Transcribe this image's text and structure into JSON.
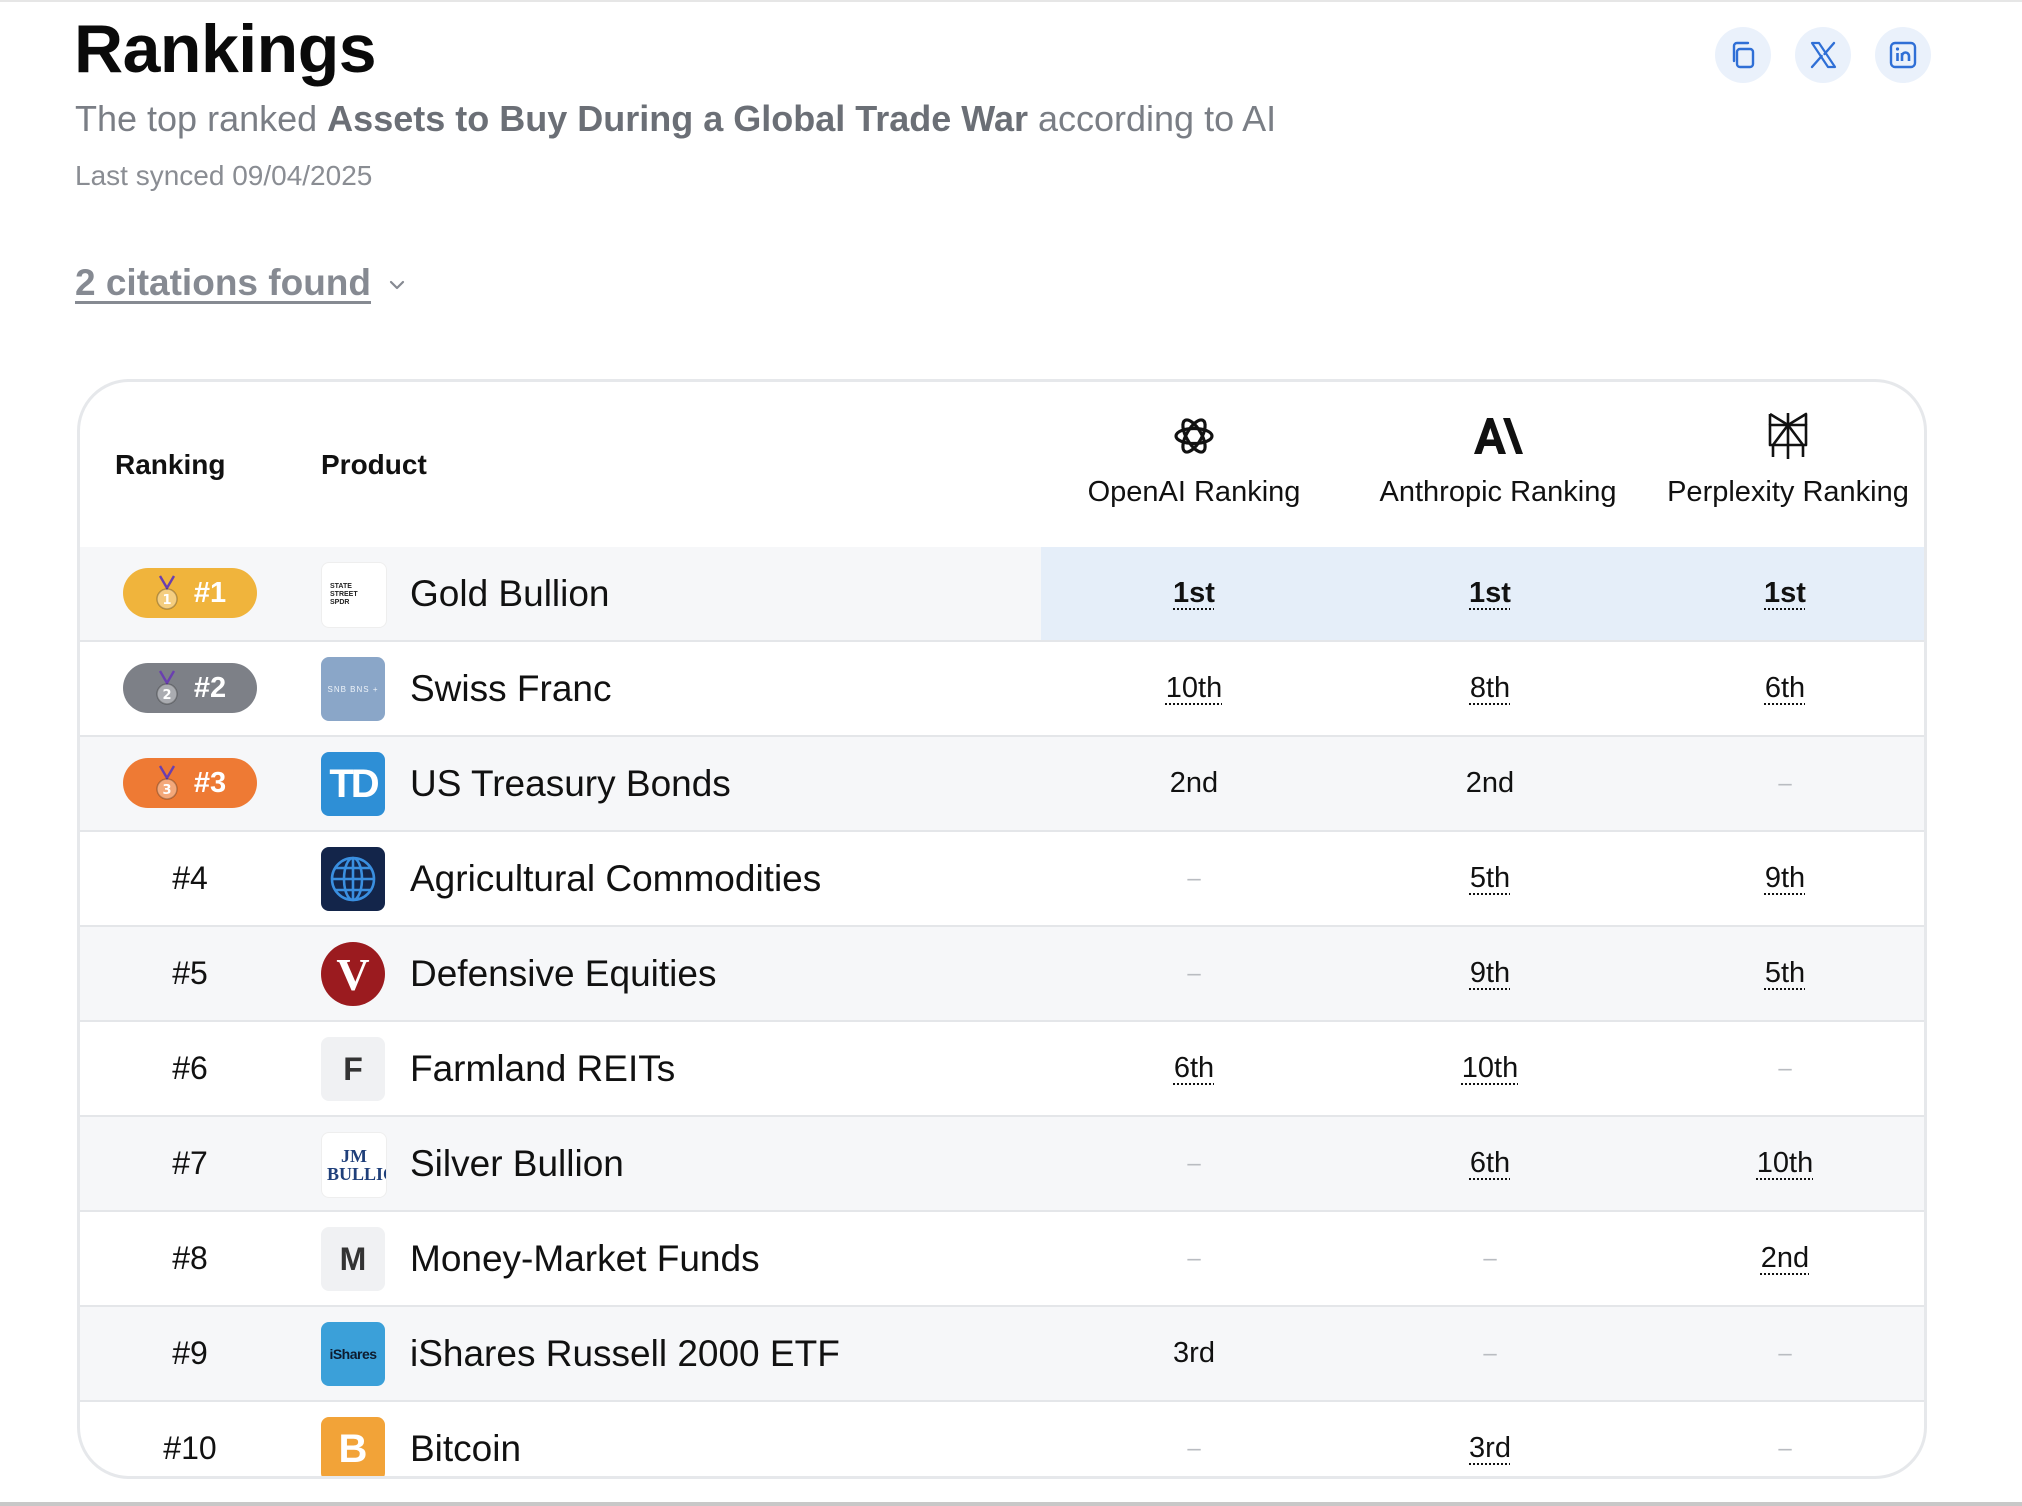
{
  "header": {
    "title": "Rankings",
    "subtitle_prefix": "The top ranked ",
    "subtitle_topic": "Assets to Buy During a Global Trade War",
    "subtitle_suffix": " according to AI",
    "last_synced": "Last synced 09/04/2025"
  },
  "share_icons": [
    "copy-icon",
    "x-twitter-icon",
    "linkedin-icon"
  ],
  "citations": {
    "label": "2 citations found"
  },
  "table": {
    "col_ranking": "Ranking",
    "col_product": "Product",
    "models": [
      {
        "label": "OpenAI Ranking",
        "icon": "openai-logo-icon"
      },
      {
        "label": "Anthropic Ranking",
        "icon": "anthropic-logo-icon"
      },
      {
        "label": "Perplexity Ranking",
        "icon": "perplexity-logo-icon"
      }
    ],
    "rows": [
      {
        "rank": "#1",
        "medal": "1",
        "product": "Gold Bullion",
        "logo_text": "STATE STREET SPDR",
        "openai": "1st",
        "anthropic": "1st",
        "perplexity": "1st"
      },
      {
        "rank": "#2",
        "medal": "2",
        "product": "Swiss Franc",
        "logo_text": "SNB BNS +",
        "openai": "10th",
        "anthropic": "8th",
        "perplexity": "6th"
      },
      {
        "rank": "#3",
        "medal": "3",
        "product": "US Treasury Bonds",
        "logo_text": "TD",
        "openai": "2nd",
        "anthropic": "2nd",
        "perplexity": "–"
      },
      {
        "rank": "#4",
        "product": "Agricultural Commodities",
        "logo_text": "",
        "openai": "–",
        "anthropic": "5th",
        "perplexity": "9th"
      },
      {
        "rank": "#5",
        "product": "Defensive Equities",
        "logo_text": "V",
        "openai": "–",
        "anthropic": "9th",
        "perplexity": "5th"
      },
      {
        "rank": "#6",
        "product": "Farmland REITs",
        "logo_text": "F",
        "openai": "6th",
        "anthropic": "10th",
        "perplexity": "–"
      },
      {
        "rank": "#7",
        "product": "Silver Bullion",
        "logo_text": "JM BULLION",
        "openai": "–",
        "anthropic": "6th",
        "perplexity": "10th"
      },
      {
        "rank": "#8",
        "product": "Money-Market Funds",
        "logo_text": "M",
        "openai": "–",
        "anthropic": "–",
        "perplexity": "2nd"
      },
      {
        "rank": "#9",
        "product": "iShares Russell 2000 ETF",
        "logo_text": "iShares",
        "openai": "3rd",
        "anthropic": "–",
        "perplexity": "–"
      },
      {
        "rank": "#10",
        "product": "Bitcoin",
        "logo_text": "B",
        "openai": "–",
        "anthropic": "3rd",
        "perplexity": "–"
      }
    ]
  },
  "colors": {
    "gold": "#f0b43c",
    "silver": "#7d8087",
    "bronze": "#ee7a34",
    "highlight_row": "#e5eef9",
    "share_bg": "#eaf1fb",
    "accent_blue": "#2f6fd6"
  }
}
